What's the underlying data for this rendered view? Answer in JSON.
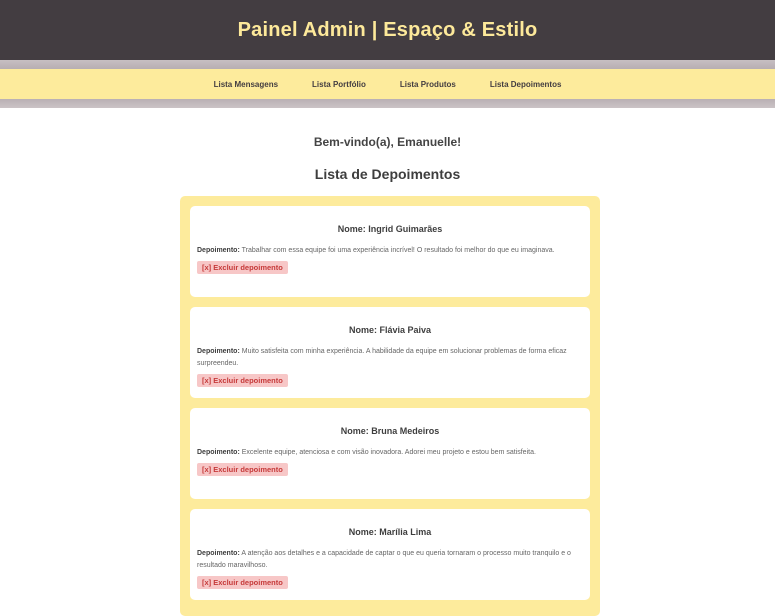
{
  "header": {
    "title": "Painel Admin | Espaço & Estilo"
  },
  "nav": {
    "items": [
      {
        "label": "Lista Mensagens"
      },
      {
        "label": "Lista Portfólio"
      },
      {
        "label": "Lista Produtos"
      },
      {
        "label": "Lista Depoimentos"
      }
    ]
  },
  "main": {
    "welcome": "Bem-vindo(a), Emanuelle!",
    "list_title": "Lista de Depoimentos",
    "testimonials": [
      {
        "name_label": "Nome: Ingrid Guimarães",
        "text_label": "Depoimento:",
        "text": "Trabalhar com essa equipe foi uma experiência incrível! O resultado foi melhor do que eu imaginava.",
        "delete_label": "[x] Excluir depoimento"
      },
      {
        "name_label": "Nome: Flávia Paiva",
        "text_label": "Depoimento:",
        "text": "Muito satisfeita com minha experiência. A habilidade da equipe em solucionar problemas de forma eficaz surpreendeu.",
        "delete_label": "[x] Excluir depoimento"
      },
      {
        "name_label": "Nome: Bruna Medeiros",
        "text_label": "Depoimento:",
        "text": "Excelente equipe, atenciosa e com visão inovadora. Adorei meu projeto e estou bem satisfeita.",
        "delete_label": "[x] Excluir depoimento"
      },
      {
        "name_label": "Nome: Marília Lima",
        "text_label": "Depoimento:",
        "text": "A atenção aos detalhes e a capacidade de captar o que eu queria tornaram o processo muito tranquilo e o resultado maravilhoso.",
        "delete_label": "[x] Excluir depoimento"
      }
    ]
  },
  "colors": {
    "header_bg": "#433d41",
    "accent_yellow": "#fdeb9c",
    "delete_bg": "#f7c7c7",
    "delete_text": "#c63a3a"
  }
}
